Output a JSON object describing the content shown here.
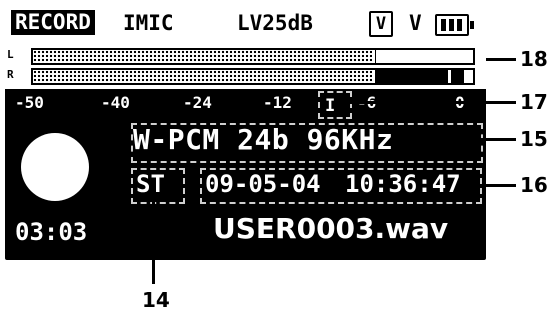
{
  "status_bar": {
    "mode": "RECORD",
    "mic": "IMIC",
    "level": "LV25dB",
    "v_box": "V",
    "v_plain": "V"
  },
  "meter": {
    "left_label": "L",
    "right_label": "R",
    "left_level_fraction": 0.78,
    "right_level_fraction": 0.99,
    "scale": [
      "-50",
      "-40",
      "-24",
      "-12",
      "-6",
      "0"
    ],
    "marker": "I"
  },
  "info": {
    "format": "W-PCM 24b 96KHz",
    "channel": "ST",
    "date": "09-05-04",
    "time": "10:36:47",
    "elapsed": "03:03",
    "filename": "USER0003.wav"
  },
  "callouts": [
    "18",
    "17",
    "15",
    "16",
    "14"
  ],
  "colors": {
    "screen": "#000000",
    "text": "#ffffff",
    "dashed_box": "#cfcfcf"
  }
}
